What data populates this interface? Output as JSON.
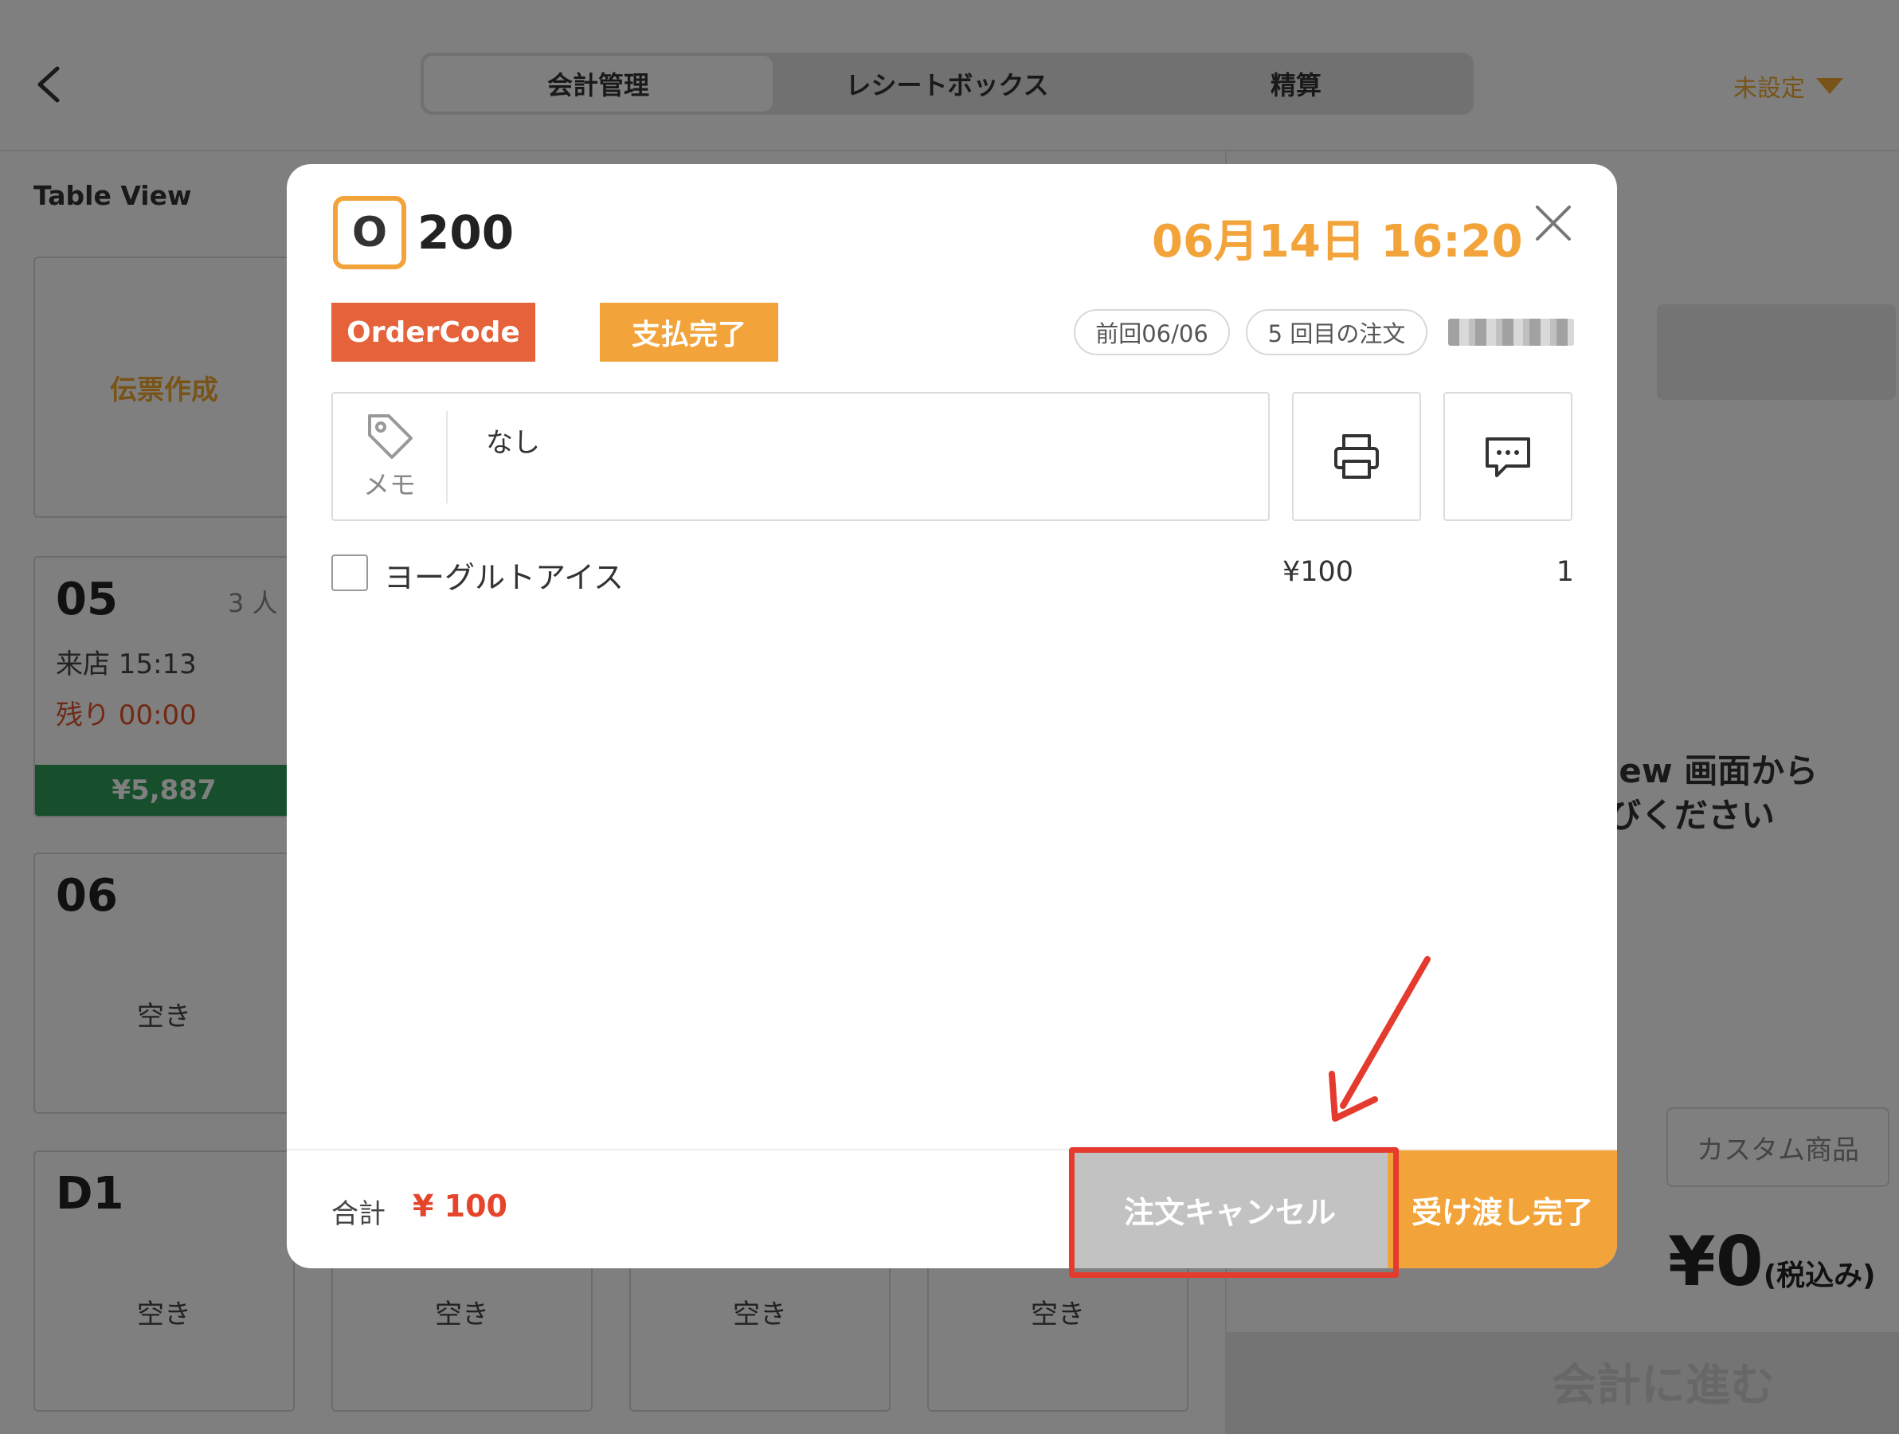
{
  "header": {
    "tabs": [
      {
        "label": "会計管理",
        "active": true
      },
      {
        "label": "レシートボックス",
        "active": false
      },
      {
        "label": "精算",
        "active": false
      }
    ],
    "settings_label": "未設定"
  },
  "table_view": {
    "title": "Table View",
    "create_label": "伝票作成",
    "tables": [
      {
        "number": "05",
        "people": "3 人",
        "visit": "来店 15:13",
        "remaining": "残り 00:00",
        "amount": "¥5,887"
      },
      {
        "number": "06",
        "status": "空き"
      },
      {
        "number": "D1",
        "status": "空き"
      }
    ],
    "bottom_row_status": [
      "空き",
      "空き",
      "空き"
    ]
  },
  "right_panel": {
    "hint_line1": "iew 画面から",
    "hint_line2": "びください",
    "custom_item_label": "カスタム商品",
    "total_value": "¥0",
    "total_suffix": "(税込み)",
    "bottom_action_partial": "会計に進む"
  },
  "modal": {
    "order_prefix": "O",
    "order_number": "200",
    "datetime": "06月14日 16:20",
    "tag_ordercode": "OrderCode",
    "tag_paid": "支払完了",
    "previous_visit": "前回06/06",
    "order_count": "5 回目の注文",
    "memo_label": "メモ",
    "memo_text": "なし",
    "items": [
      {
        "name": "ヨーグルトアイス",
        "price": "¥100",
        "qty": "1"
      }
    ],
    "total_label": "合計",
    "total_value": "¥ 100",
    "cancel_label": "注文キャンセル",
    "handover_label": "受け渡し完了"
  },
  "colors": {
    "accent_orange": "#f2a43a",
    "order_code_red": "#e5623a",
    "total_red": "#e5452b",
    "annotation_red": "#e53a2e",
    "table_amount_green": "#2e9e5a"
  }
}
